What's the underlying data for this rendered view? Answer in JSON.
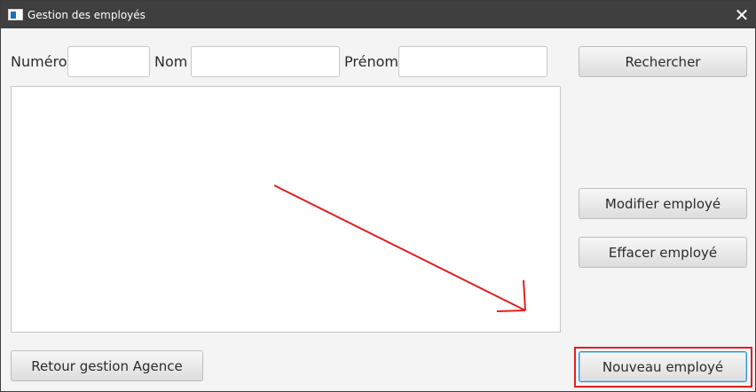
{
  "window": {
    "title": "Gestion des employés",
    "close_icon": "✕"
  },
  "search": {
    "numero_label": "Numéro",
    "numero_value": "",
    "nom_label": "Nom",
    "nom_value": "",
    "prenom_label": "Prénom",
    "prenom_value": ""
  },
  "buttons": {
    "rechercher": "Rechercher",
    "modifier": "Modifier employé",
    "effacer": "Effacer employé",
    "retour": "Retour gestion Agence",
    "nouveau": "Nouveau employé"
  },
  "employee_list": {
    "items": []
  },
  "annotation": {
    "highlight_color": "#e02020",
    "arrow_color": "#e02020"
  },
  "colors": {
    "titlebar": "#3f3f3f",
    "background": "#f4f4f4",
    "focus_border": "#2b8fd6"
  }
}
